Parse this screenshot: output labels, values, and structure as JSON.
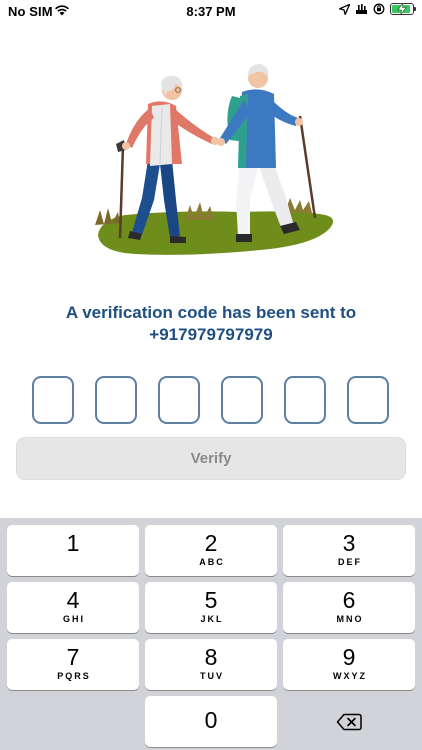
{
  "status_bar": {
    "carrier": "No SIM",
    "time": "8:37 PM",
    "battery_level": 0.9,
    "icons": [
      "wifi-icon",
      "location-icon",
      "vpn-icon",
      "rotation-lock-icon",
      "battery-icon"
    ]
  },
  "illustration": {
    "name": "elderly-couple-hiking-illustration",
    "colors": {
      "grass": "#6f8d1b",
      "woman_shirt": "#e07868",
      "woman_vest": "#e9e9ea",
      "woman_pants": "#1d4f8f",
      "man_shirt": "#3d79c1",
      "man_pants": "#f4f4f6",
      "backpack": "#2f9f8f",
      "hair": "#e3e3e3"
    }
  },
  "verification": {
    "line1": "A verification code has been sent to",
    "phone": "+917979797979",
    "code_length": 6
  },
  "verify_label": "Verify",
  "keypad": {
    "keys": [
      {
        "digit": "1",
        "letters": ""
      },
      {
        "digit": "2",
        "letters": "ABC"
      },
      {
        "digit": "3",
        "letters": "DEF"
      },
      {
        "digit": "4",
        "letters": "GHI"
      },
      {
        "digit": "5",
        "letters": "JKL"
      },
      {
        "digit": "6",
        "letters": "MNO"
      },
      {
        "digit": "7",
        "letters": "PQRS"
      },
      {
        "digit": "8",
        "letters": "TUV"
      },
      {
        "digit": "9",
        "letters": "WXYZ"
      },
      {
        "digit": "0",
        "letters": ""
      }
    ],
    "delete_icon": "backspace-icon"
  },
  "colors": {
    "accent": "#1f4f82",
    "otp_border": "#5c7fa3",
    "button_bg": "#e6e6e6",
    "keypad_bg": "#d1d3d9"
  }
}
